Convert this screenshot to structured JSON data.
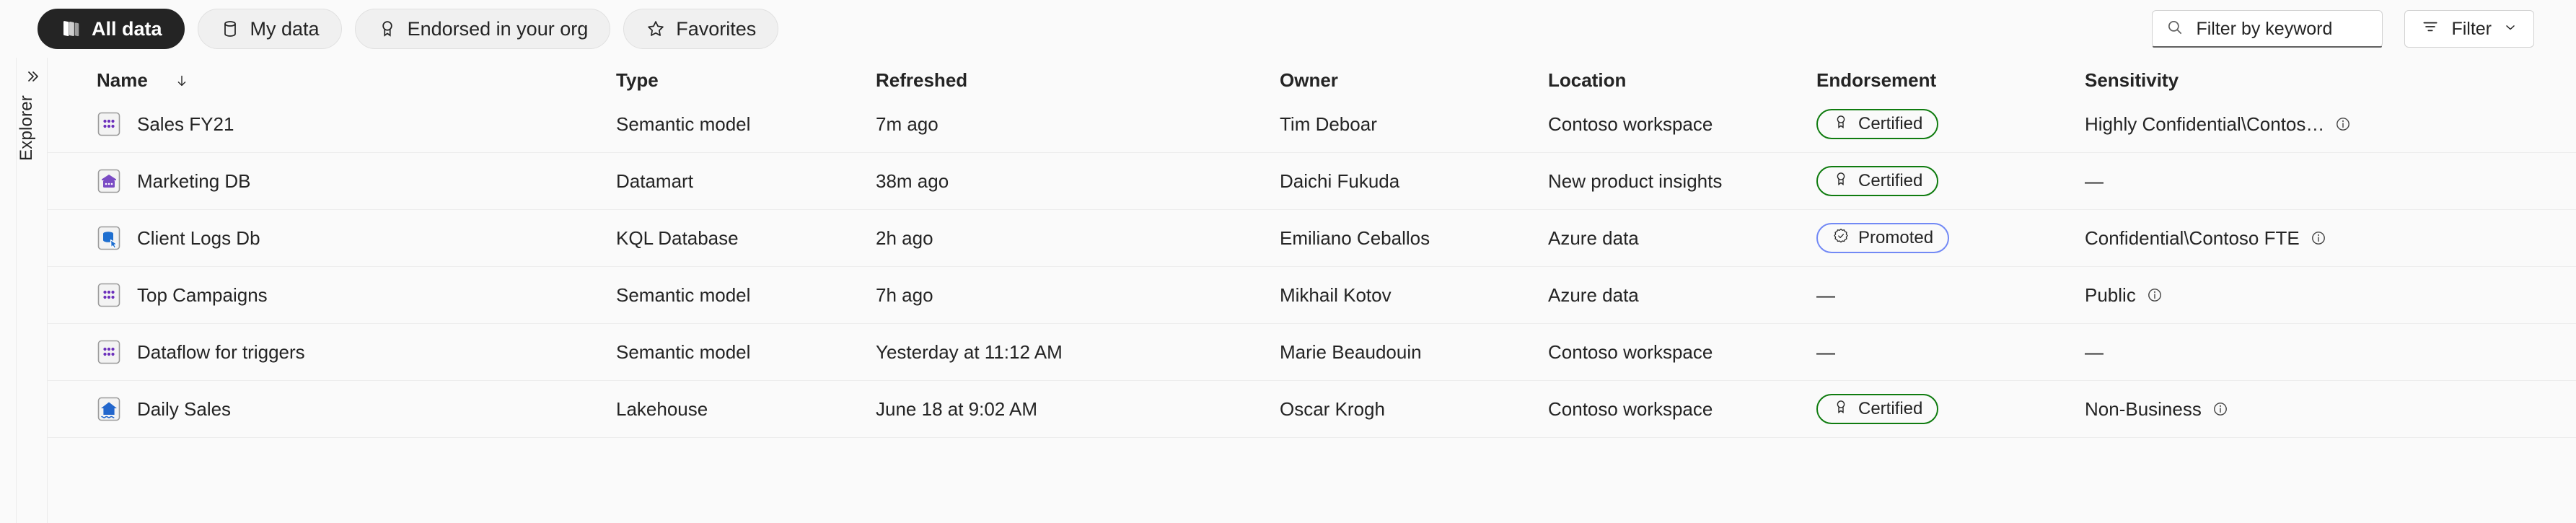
{
  "toolbar": {
    "pills": [
      {
        "label": "All data",
        "icon": "books-icon",
        "active": true
      },
      {
        "label": "My data",
        "icon": "database-icon",
        "active": false
      },
      {
        "label": "Endorsed in your org",
        "icon": "certified-badge-icon",
        "active": false
      },
      {
        "label": "Favorites",
        "icon": "star-icon",
        "active": false
      }
    ],
    "search": {
      "placeholder": "Filter by keyword",
      "value": "",
      "icon": "search-icon"
    },
    "filter": {
      "label": "Filter",
      "icon": "filter-lines-icon",
      "chevron": "chevron-down-icon"
    }
  },
  "explorer": {
    "label": "Explorer",
    "toggle_icon": "chevron-double-right-icon"
  },
  "table": {
    "columns": [
      {
        "label": "Name",
        "sorted": true,
        "sort_icon": "arrow-down-icon"
      },
      {
        "label": "Type"
      },
      {
        "label": "Refreshed"
      },
      {
        "label": "Owner"
      },
      {
        "label": "Location"
      },
      {
        "label": "Endorsement"
      },
      {
        "label": "Sensitivity"
      }
    ],
    "rows": [
      {
        "icon": "semantic-model-icon",
        "name": "Sales FY21",
        "type": "Semantic model",
        "refreshed": "7m ago",
        "owner": "Tim Deboar",
        "location": "Contoso workspace",
        "endorsement": "Certified",
        "endorsement_kind": "certified",
        "endorsement_icon": "certified-badge-icon",
        "sensitivity": "Highly Confidential\\Contos…",
        "sensitivity_info": true
      },
      {
        "icon": "datamart-icon",
        "name": "Marketing DB",
        "type": "Datamart",
        "refreshed": "38m ago",
        "owner": "Daichi Fukuda",
        "location": "New product insights",
        "endorsement": "Certified",
        "endorsement_kind": "certified",
        "endorsement_icon": "certified-badge-icon",
        "sensitivity": "—",
        "sensitivity_info": false
      },
      {
        "icon": "kql-database-icon",
        "name": "Client Logs Db",
        "type": "KQL Database",
        "refreshed": "2h ago",
        "owner": "Emiliano Ceballos",
        "location": "Azure data",
        "endorsement": "Promoted",
        "endorsement_kind": "promoted",
        "endorsement_icon": "promoted-starburst-icon",
        "sensitivity": "Confidential\\Contoso FTE",
        "sensitivity_info": true
      },
      {
        "icon": "semantic-model-icon",
        "name": "Top Campaigns",
        "type": "Semantic model",
        "refreshed": "7h ago",
        "owner": "Mikhail Kotov",
        "location": "Azure data",
        "endorsement": "—",
        "endorsement_kind": "none",
        "endorsement_icon": "",
        "sensitivity": "Public",
        "sensitivity_info": true
      },
      {
        "icon": "semantic-model-icon",
        "name": "Dataflow for triggers",
        "type": "Semantic model",
        "refreshed": "Yesterday at 11:12 AM",
        "owner": "Marie Beaudouin",
        "location": "Contoso workspace",
        "endorsement": "—",
        "endorsement_kind": "none",
        "endorsement_icon": "",
        "sensitivity": "—",
        "sensitivity_info": false
      },
      {
        "icon": "lakehouse-icon",
        "name": "Daily Sales",
        "type": "Lakehouse",
        "refreshed": "June 18 at 9:02 AM",
        "owner": "Oscar Krogh",
        "location": "Contoso workspace",
        "endorsement": "Certified",
        "endorsement_kind": "certified",
        "endorsement_icon": "certified-badge-icon",
        "sensitivity": "Non-Business",
        "sensitivity_info": true
      }
    ]
  },
  "colors": {
    "page_bg": "#fafafa",
    "active_pill_bg": "#242424",
    "certified_border": "#107c10",
    "promoted_border": "#7289f5",
    "semantic_model_accent": "#6b2fbb",
    "datamart_accent": "#7a4bc4",
    "kql_accent": "#1f6fd0",
    "lakehouse_accent": "#2266cc",
    "row_divider": "#ededed"
  }
}
